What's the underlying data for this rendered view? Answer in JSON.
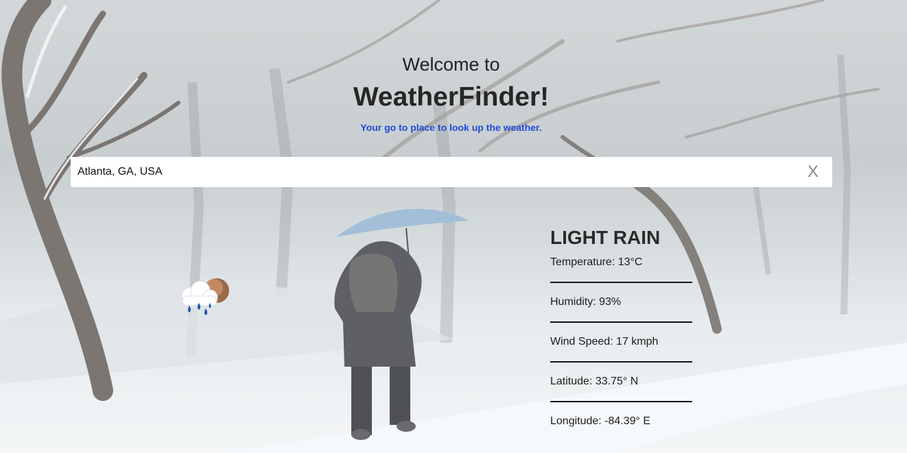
{
  "header": {
    "welcome": "Welcome to",
    "title": "WeatherFinder!",
    "tagline": "Your go to place to look up the weather."
  },
  "search": {
    "value": "Atlanta, GA, USA",
    "clear_label": "X"
  },
  "weather": {
    "icon": "light-rain-icon",
    "condition": "LIGHT RAIN",
    "temperature": "Temperature: 13°C",
    "humidity": "Humidity: 93%",
    "wind_speed": "Wind Speed: 17 kmph",
    "latitude": "Latitude: 33.75° N",
    "longitude": "Longitude: -84.39° E"
  },
  "colors": {
    "tagline": "#2448d8",
    "title": "#262626",
    "search_bg": "#ffffff"
  }
}
